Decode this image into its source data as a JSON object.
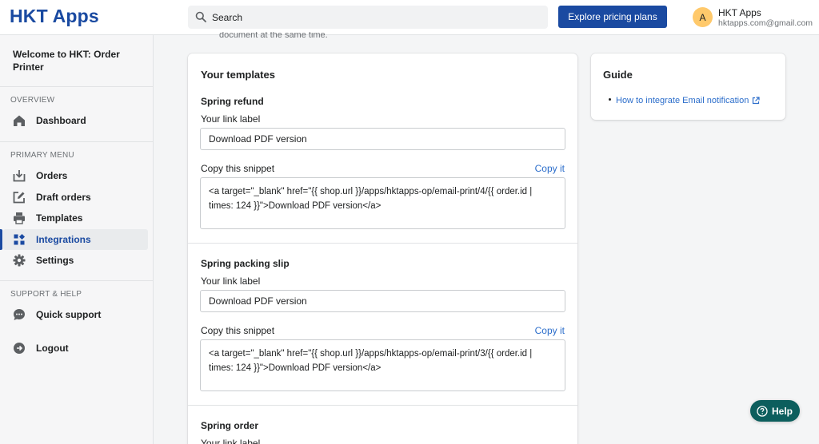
{
  "app": {
    "title": "HKT Apps"
  },
  "search": {
    "placeholder": "Search"
  },
  "header": {
    "pricing_button": "Explore pricing plans",
    "user": {
      "avatar_initial": "A",
      "name": "HKT Apps",
      "email": "hktapps.com@gmail.com"
    }
  },
  "sidebar": {
    "welcome": "Welcome to HKT: Order Printer",
    "overview_label": "OVERVIEW",
    "primary_menu_label": "PRIMARY MENU",
    "support_label": "SUPPORT & HELP",
    "items": [
      {
        "label": "Dashboard",
        "icon": "home-icon",
        "active": false
      },
      {
        "label": "Orders",
        "icon": "download-box-icon",
        "active": false
      },
      {
        "label": "Draft orders",
        "icon": "draft-edit-icon",
        "active": false
      },
      {
        "label": "Templates",
        "icon": "printer-icon",
        "active": false
      },
      {
        "label": "Integrations",
        "icon": "integrations-icon",
        "active": true
      },
      {
        "label": "Settings",
        "icon": "gear-icon",
        "active": false
      },
      {
        "label": "Quick support",
        "icon": "chat-icon",
        "active": false
      },
      {
        "label": "Logout",
        "icon": "logout-icon",
        "active": false
      }
    ]
  },
  "main": {
    "faded_text": "document at the same time.",
    "templates_card": {
      "title": "Your templates",
      "link_label_caption": "Your link label",
      "snippet_caption": "Copy this snippet",
      "copy_label": "Copy it",
      "templates": [
        {
          "name": "Spring refund",
          "link_label": "Download PDF version",
          "snippet": "<a target=\"_blank\" href=\"{{ shop.url }}/apps/hktapps-op/email-print/4/{{ order.id | times: 124 }}\">Download PDF version</a>"
        },
        {
          "name": "Spring packing slip",
          "link_label": "Download PDF version",
          "snippet": "<a target=\"_blank\" href=\"{{ shop.url }}/apps/hktapps-op/email-print/3/{{ order.id | times: 124 }}\">Download PDF version</a>"
        },
        {
          "name": "Spring order",
          "link_label": "",
          "snippet": ""
        }
      ]
    },
    "guide_card": {
      "title": "Guide",
      "link": "How to integrate Email notification"
    }
  },
  "help_button": {
    "label": "Help"
  }
}
